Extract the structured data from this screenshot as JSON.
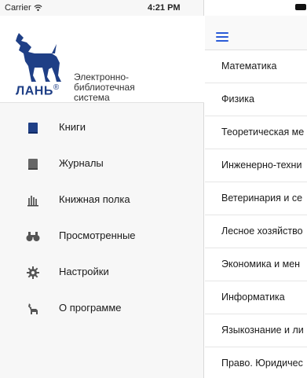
{
  "status_bar": {
    "carrier": "Carrier",
    "time": "4:21 PM"
  },
  "brand": {
    "logo_text": "ЛАНЬ",
    "registered": "®",
    "tagline": [
      "Электронно-",
      "библиотечная",
      "система"
    ]
  },
  "menu": {
    "items": [
      {
        "label": "Книги",
        "icon": "book-icon"
      },
      {
        "label": "Журналы",
        "icon": "journal-icon"
      },
      {
        "label": "Книжная полка",
        "icon": "bookshelf-icon"
      },
      {
        "label": "Просмотренные",
        "icon": "binoculars-icon"
      },
      {
        "label": "Настройки",
        "icon": "gear-icon"
      },
      {
        "label": "О программе",
        "icon": "deer-icon"
      }
    ]
  },
  "content": {
    "subjects": [
      "Математика",
      "Физика",
      "Теоретическая ме",
      "Инженерно-техни",
      "Ветеринария и се",
      "Лесное хозяйство",
      "Экономика и мен",
      "Информатика",
      "Языкознание и ли",
      "Право. Юридичес"
    ]
  },
  "colors": {
    "accent": "#2a5bd7",
    "brand": "#1f3f86",
    "icon": "#555555"
  }
}
